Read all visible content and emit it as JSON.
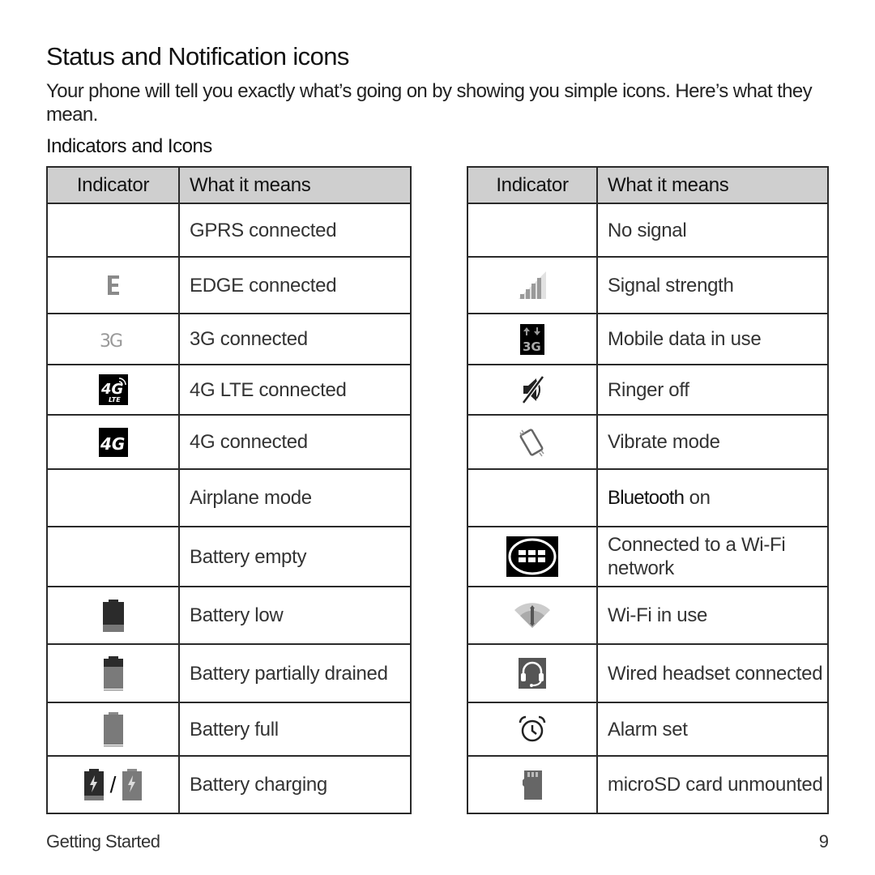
{
  "page": {
    "title": "Status and Notification icons",
    "intro": "Your phone will tell you exactly what’s going on by showing you simple icons. Here’s what they mean.",
    "subhead": "Indicators and Icons",
    "footer_section": "Getting Started",
    "page_number": "9"
  },
  "tables": {
    "left": {
      "headers": [
        "Indicator",
        "What it means"
      ],
      "rows": [
        {
          "icon": "none",
          "text": "GPRS connected"
        },
        {
          "icon": "edge-icon",
          "text": "EDGE connected"
        },
        {
          "icon": "3g-icon",
          "text": "3G connected"
        },
        {
          "icon": "4g-lte-icon",
          "text": "4G LTE connected"
        },
        {
          "icon": "4g-icon",
          "text": "4G connected"
        },
        {
          "icon": "none",
          "text": "Airplane mode"
        },
        {
          "icon": "none",
          "text": "Battery empty"
        },
        {
          "icon": "battery-low-icon",
          "text": "Battery low"
        },
        {
          "icon": "battery-partial-icon",
          "text": "Battery partially drained"
        },
        {
          "icon": "battery-full-icon",
          "text": "Battery full"
        },
        {
          "icon": "battery-charging-icon",
          "text": "Battery charging",
          "separator": "/"
        }
      ]
    },
    "right": {
      "headers": [
        "Indicator",
        "What it means"
      ],
      "rows": [
        {
          "icon": "none",
          "text": "No signal"
        },
        {
          "icon": "signal-strength-icon",
          "text": "Signal strength"
        },
        {
          "icon": "mobile-data-3g-icon",
          "text": "Mobile data in use"
        },
        {
          "icon": "ringer-off-icon",
          "text": "Ringer off"
        },
        {
          "icon": "vibrate-icon",
          "text": "Vibrate mode"
        },
        {
          "icon": "none",
          "text_strong": "Bluetooth",
          "text": "on"
        },
        {
          "icon": "wifi-network-icon",
          "text": "Connected to a Wi-Fi network"
        },
        {
          "icon": "wifi-in-use-icon",
          "text": "Wi-Fi in use"
        },
        {
          "icon": "headset-icon",
          "text": "Wired headset connected"
        },
        {
          "icon": "alarm-icon",
          "text": "Alarm set"
        },
        {
          "icon": "microsd-icon",
          "text": "microSD card unmounted"
        }
      ]
    }
  },
  "colors": {
    "header_bg": "#cfcfcf",
    "border": "#2a2a2a",
    "icon_dark": "#2b2b2b",
    "icon_gray": "#7a7a7a"
  }
}
